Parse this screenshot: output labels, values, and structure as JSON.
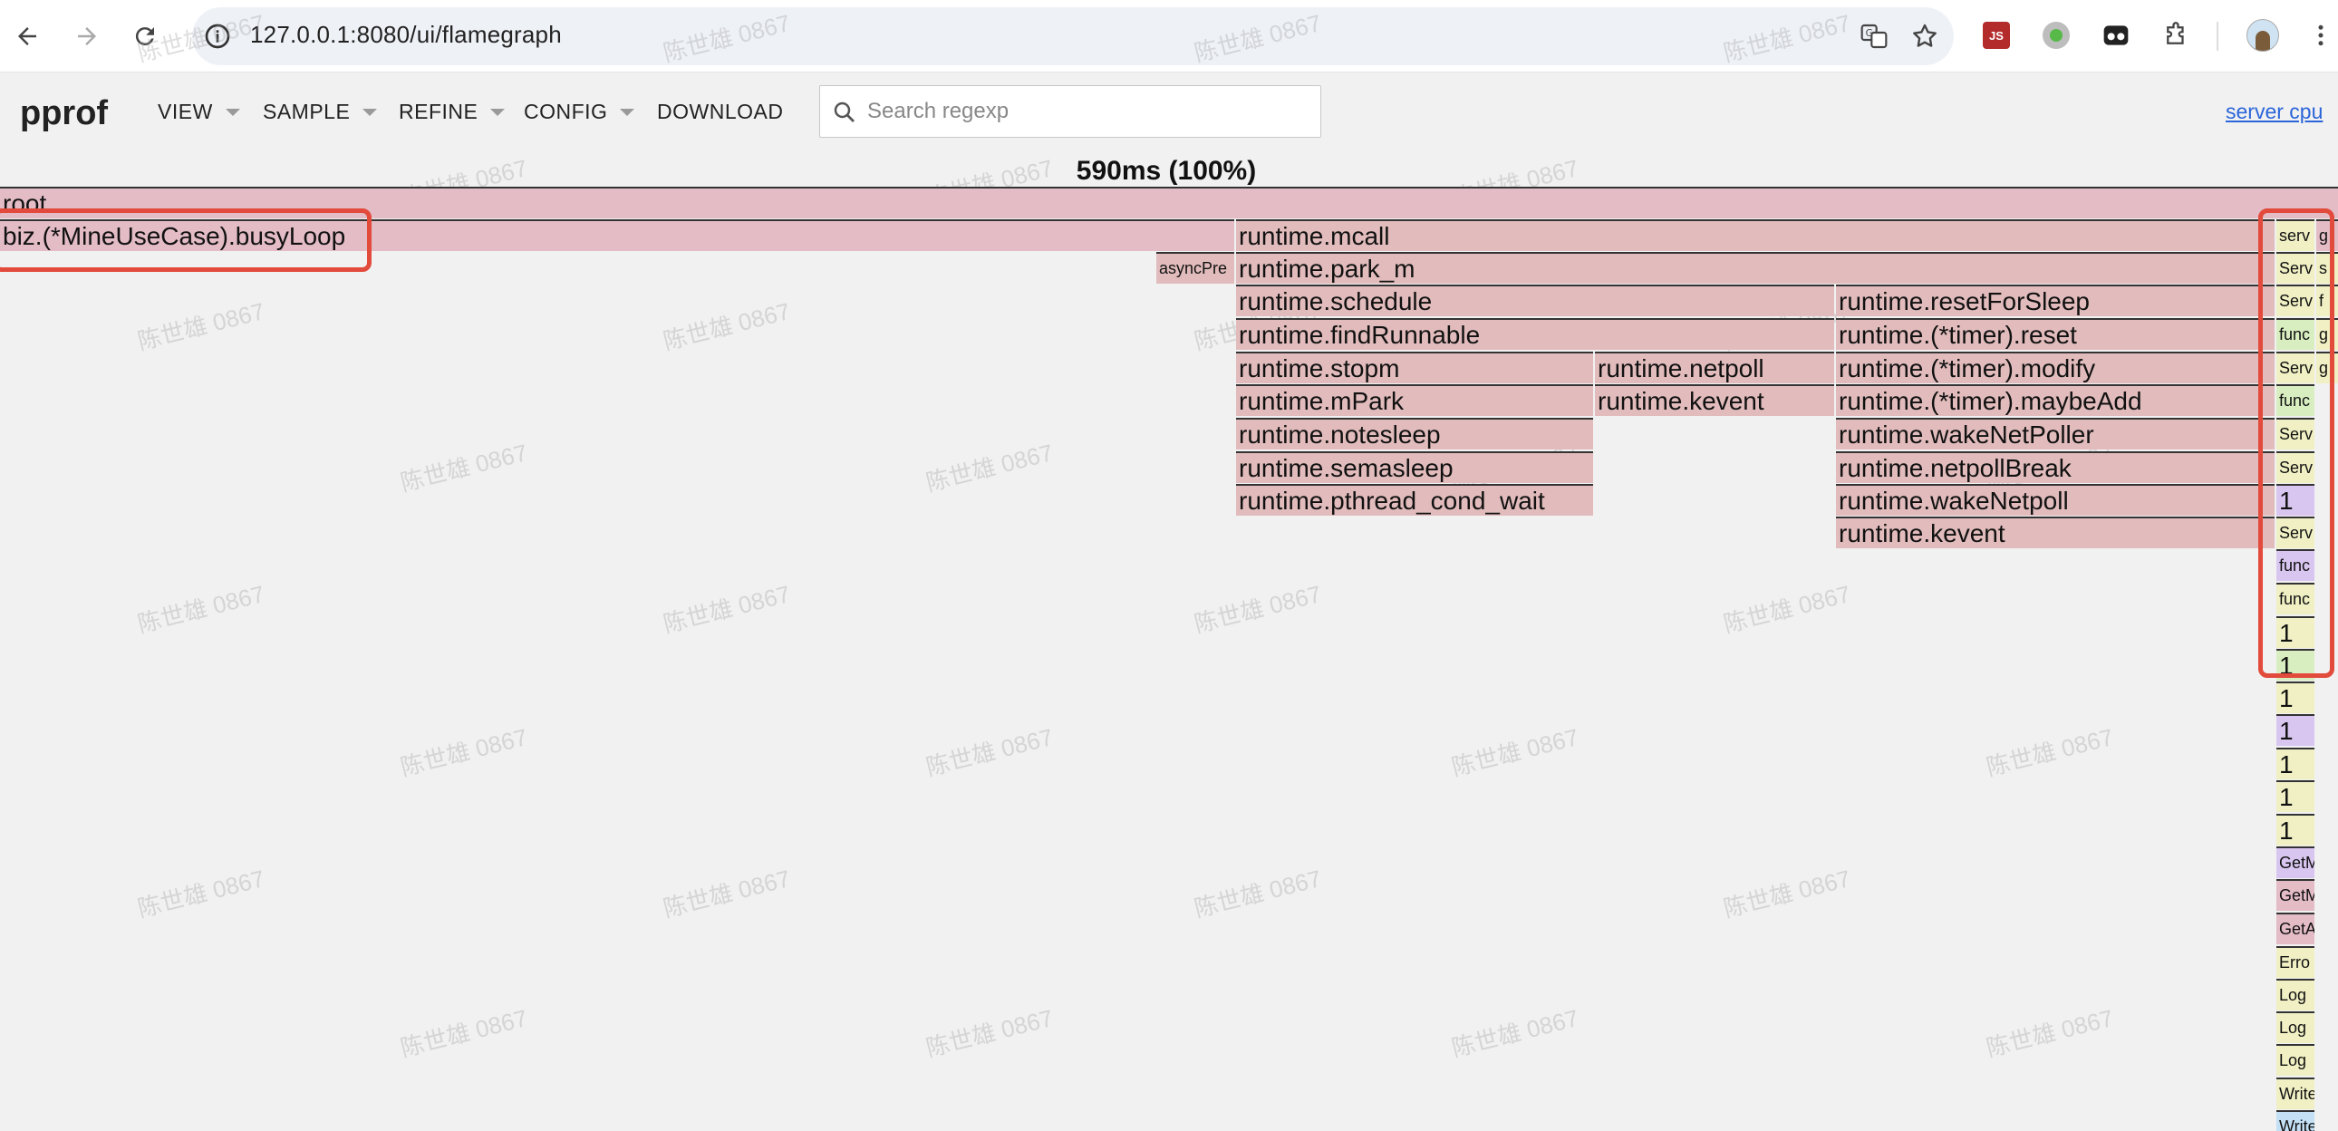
{
  "browser": {
    "url": "127.0.0.1:8080/ui/flamegraph",
    "ext_js_label": "JS"
  },
  "pprof": {
    "logo": "pprof",
    "menus": [
      "VIEW",
      "SAMPLE",
      "REFINE",
      "CONFIG",
      "DOWNLOAD"
    ],
    "search_placeholder": "Search regexp",
    "profile_link": "server cpu",
    "total": "590ms (100%)"
  },
  "flame": {
    "root": "root",
    "frames": {
      "busyLoop": "biz.(*MineUseCase).busyLoop",
      "mcall": "runtime.mcall",
      "asyncPreempt": "asyncPre",
      "park_m": "runtime.park_m",
      "schedule": "runtime.schedule",
      "findRunnable": "runtime.findRunnable",
      "stopm": "runtime.stopm",
      "mPark": "runtime.mPark",
      "notesleep": "runtime.notesleep",
      "semasleep": "runtime.semasleep",
      "pthread_cond_wait": "runtime.pthread_cond_wait",
      "netpoll": "runtime.netpoll",
      "kevent1": "runtime.kevent",
      "resetForSleep": "runtime.resetForSleep",
      "timer_reset": "runtime.(*timer).reset",
      "timer_modify": "runtime.(*timer).modify",
      "timer_maybeAdd": "runtime.(*timer).maybeAdd",
      "wakeNetPoller": "runtime.wakeNetPoller",
      "netpollBreak": "runtime.netpollBreak",
      "wakeNetpoll": "runtime.wakeNetpoll",
      "kevent2": "runtime.kevent"
    },
    "narrow_column": [
      "serv",
      "Serv",
      "Serv",
      "func",
      "Serv",
      "func",
      "Serv",
      "Serv",
      "1",
      "Serv",
      "func",
      "func",
      "1",
      "1",
      "1",
      "1",
      "1",
      "1",
      "1",
      "GetM",
      "GetM",
      "GetA",
      "Erro",
      "Log",
      "Log",
      "Log",
      "Write",
      "Write"
    ],
    "side_column": [
      "g",
      "s",
      "f",
      "g",
      "g"
    ]
  },
  "watermark": "陈世雄 0867"
}
